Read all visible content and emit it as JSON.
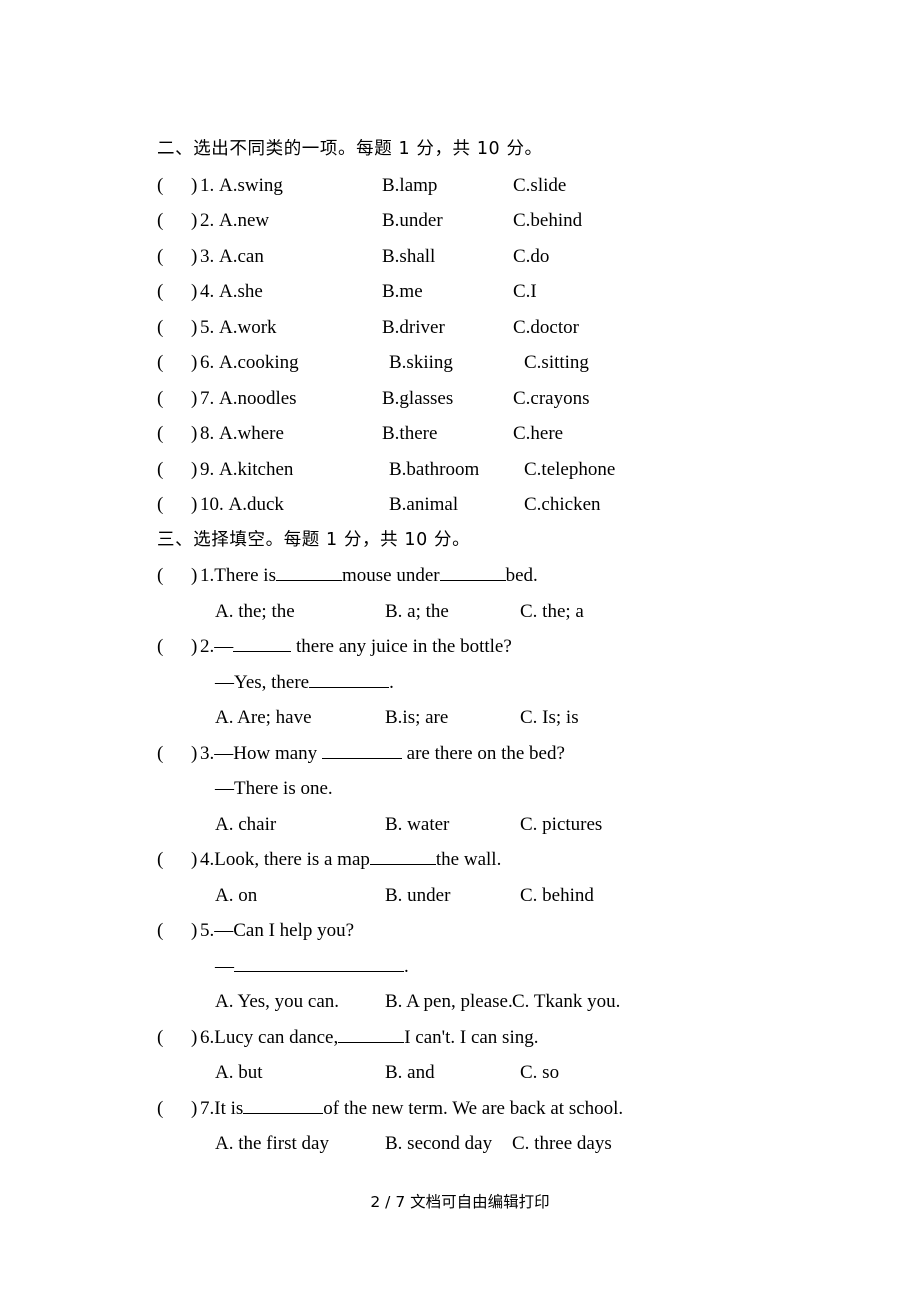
{
  "document": {
    "footer": "2 / 7 文档可自由编辑打印"
  },
  "sections": [
    {
      "heading": "二、选出不同类的一项。每题 1 分，共 10 分。",
      "type": "odd-one-out",
      "questions": [
        {
          "paren_open": "(",
          "paren_close": ")",
          "number": "1.",
          "a": "A.swing",
          "b": "B.lamp",
          "c": "C.slide"
        },
        {
          "paren_open": "(",
          "paren_close": ")",
          "number": "2.",
          "a": "A.new",
          "b": "B.under",
          "c": "C.behind"
        },
        {
          "paren_open": "(",
          "paren_close": ")",
          "number": "3.",
          "a": "A.can",
          "b": "B.shall",
          "c": "C.do"
        },
        {
          "paren_open": "(",
          "paren_close": ")",
          "number": "4.",
          "a": "A.she",
          "b": "B.me",
          "c": "C.I"
        },
        {
          "paren_open": "(",
          "paren_close": ")",
          "number": "5.",
          "a": "A.work",
          "b": "B.driver",
          "c": "C.doctor"
        },
        {
          "paren_open": "(",
          "paren_close": ")",
          "number": "6.",
          "a": "A.cooking",
          "b": "B.skiing",
          "c": "C.sitting"
        },
        {
          "paren_open": "(",
          "paren_close": ")",
          "number": "7.",
          "a": "A.noodles",
          "b": "B.glasses",
          "c": "C.crayons"
        },
        {
          "paren_open": "(",
          "paren_close": ")",
          "number": "8.",
          "a": "A.where",
          "b": "B.there",
          "c": "C.here"
        },
        {
          "paren_open": "(",
          "paren_close": ")",
          "number": "9.",
          "a": "A.kitchen",
          "b": "B.bathroom",
          "c": "C.telephone"
        },
        {
          "paren_open": "(",
          "paren_close": ")",
          "number": "10.",
          "a": "A.duck",
          "b": "B.animal",
          "c": "C.chicken"
        }
      ]
    },
    {
      "heading": "三、选择填空。每题 1 分，共 10 分。",
      "type": "multiple-choice",
      "questions": [
        {
          "number": "1.",
          "stem_part1": "There is",
          "stem_part2": "mouse under",
          "stem_part3": "bed.",
          "choice_a": "A. the; the",
          "choice_b": "B. a; the",
          "choice_c": "C. the; a"
        },
        {
          "number": "2.",
          "stem_part1": "—",
          "stem_part2": " there any juice in the bottle?",
          "continuation_part1": "—Yes, there",
          "continuation_part2": ".",
          "choice_a": "A. Are; have",
          "choice_b": "B.is; are",
          "choice_c": "C. Is; is"
        },
        {
          "number": "3.",
          "stem_part1": "—How many ",
          "stem_part2": " are there on the bed?",
          "continuation_part1": "—There is one.",
          "choice_a": "A. chair",
          "choice_b": "B. water",
          "choice_c": "C. pictures"
        },
        {
          "number": "4.",
          "stem_part1": "Look, there is a map",
          "stem_part2": "the wall.",
          "choice_a": "A. on",
          "choice_b": "B. under",
          "choice_c": "C. behind"
        },
        {
          "number": "5.",
          "stem_part1": "—Can I help you?",
          "continuation_part1": "—",
          "continuation_part2": ".",
          "choice_a": "A. Yes, you can.",
          "choice_b": "B. A pen, please.",
          "choice_c": "C. Tkank you."
        },
        {
          "number": "6.",
          "stem_part1": "Lucy can dance,",
          "stem_part2": "I can't. I can sing.",
          "choice_a": "A. but",
          "choice_b": "B. and",
          "choice_c": "C. so"
        },
        {
          "number": "7.",
          "stem_part1": "It is",
          "stem_part2": "of the new term. We are back at school.",
          "choice_a": "A. the first day",
          "choice_b": "B. second day",
          "choice_c": "C. three days"
        }
      ]
    }
  ]
}
